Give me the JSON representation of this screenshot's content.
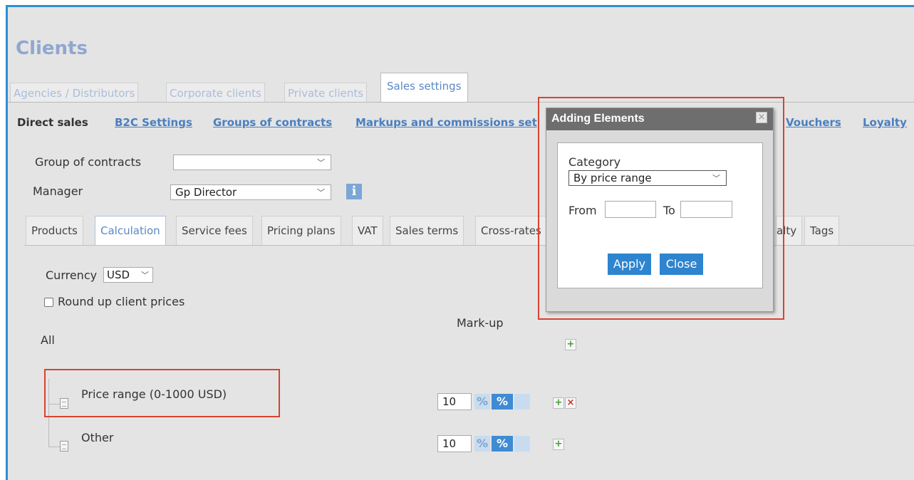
{
  "page": {
    "title": "Clients"
  },
  "top_tabs": [
    {
      "label": "Agencies / Distributors"
    },
    {
      "label": "Corporate clients"
    },
    {
      "label": "Private clients"
    },
    {
      "label": "Sales settings"
    }
  ],
  "subnav": {
    "direct_sales": "Direct sales",
    "b2c_settings": "B2C Settings",
    "groups_of_contracts": "Groups of contracts",
    "markups": "Markups and commissions set",
    "vouchers": "Vouchers",
    "loyalty": "Loyalty"
  },
  "form": {
    "group_label": "Group of contracts",
    "group_value": "",
    "manager_label": "Manager",
    "manager_value": "Gp Director",
    "info_icon": "i"
  },
  "inner_tabs": [
    {
      "label": "Products"
    },
    {
      "label": "Calculation"
    },
    {
      "label": "Service fees"
    },
    {
      "label": "Pricing plans"
    },
    {
      "label": "VAT"
    },
    {
      "label": "Sales terms"
    },
    {
      "label": "Cross-rates"
    },
    {
      "label": "alty"
    },
    {
      "label": "Tags"
    }
  ],
  "calculation": {
    "currency_label": "Currency",
    "currency_value": "USD",
    "round_up_label": "Round up client prices",
    "round_up_checked": false,
    "markup_header": "Mark-up",
    "all_label": "All",
    "percent_symbol": "%",
    "rows": [
      {
        "label": "Price range (0-1000 USD)",
        "value": "10"
      },
      {
        "label": "Other",
        "value": "10"
      }
    ]
  },
  "dialog": {
    "title": "Adding Elements",
    "close_glyph": "×",
    "category_label": "Category",
    "category_value": "By price range",
    "from_label": "From",
    "to_label": "To",
    "from_value": "",
    "to_value": "",
    "apply_label": "Apply",
    "close_label": "Close"
  },
  "colors": {
    "accent": "#2e84cf",
    "highlight": "#d9432f",
    "title": "#8fa7cf",
    "link": "#4a7fbf"
  }
}
